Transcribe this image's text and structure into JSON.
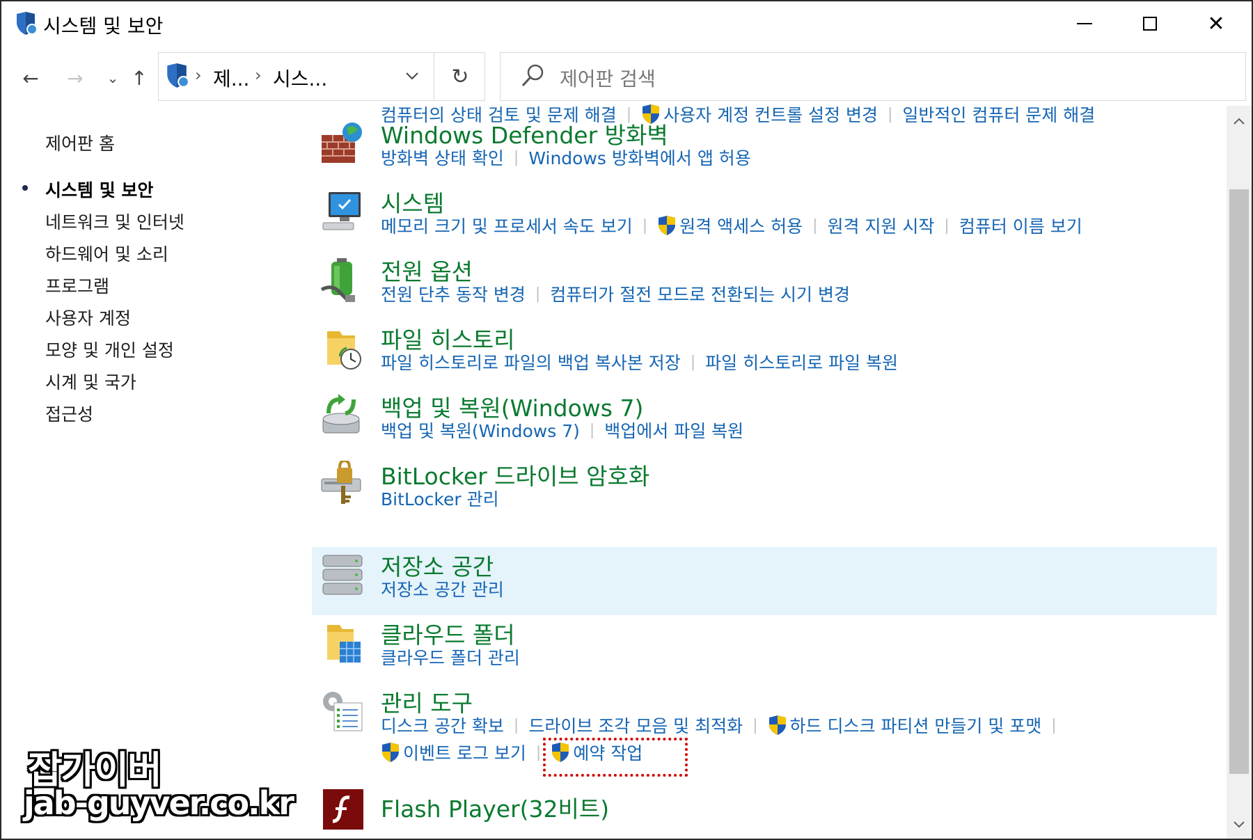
{
  "window": {
    "title": "시스템 및 보안",
    "minimize_icon": "minimize-icon",
    "maximize_icon": "maximize-icon",
    "close_glyph": "✕"
  },
  "nav": {
    "back_glyph": "←",
    "forward_glyph": "→",
    "recent_glyph": "⌄",
    "up_glyph": "↑",
    "breadcrumb_sep": "›",
    "crumbs": [
      "제...",
      "시스..."
    ],
    "refresh_glyph": "↻",
    "search_placeholder": "제어판 검색"
  },
  "sidebar": {
    "items": [
      {
        "label": "제어판 홈"
      },
      {
        "label": "시스템 및 보안",
        "active": true
      },
      {
        "label": "네트워크 및 인터넷"
      },
      {
        "label": "하드웨어 및 소리"
      },
      {
        "label": "프로그램"
      },
      {
        "label": "사용자 계정"
      },
      {
        "label": "모양 및 개인 설정"
      },
      {
        "label": "시계 및 국가"
      },
      {
        "label": "접근성"
      }
    ]
  },
  "categories": [
    {
      "title": "",
      "icon": "security-maintenance-icon",
      "links": [
        "컴퓨터의 상태 검토 및 문제 해결",
        "사용자 계정 컨트롤 설정 변경",
        "일반적인 컴퓨터 문제 해결"
      ]
    },
    {
      "title": "Windows Defender 방화벽",
      "icon": "firewall-icon",
      "links": [
        "방화벽 상태 확인",
        "Windows 방화벽에서 앱 허용"
      ]
    },
    {
      "title": "시스템",
      "icon": "computer-monitor-icon",
      "links": [
        "메모리 크기 및 프로세서 속도 보기",
        "원격 액세스 허용",
        "원격 지원 시작",
        "컴퓨터 이름 보기"
      ]
    },
    {
      "title": "전원 옵션",
      "icon": "power-battery-icon",
      "links": [
        "전원 단추 동작 변경",
        "컴퓨터가 절전 모드로 전환되는 시기 변경"
      ]
    },
    {
      "title": "파일 히스토리",
      "icon": "file-history-icon",
      "links": [
        "파일 히스토리로 파일의 백업 복사본 저장",
        "파일 히스토리로 파일 복원"
      ]
    },
    {
      "title": "백업 및 복원(Windows 7)",
      "icon": "backup-restore-icon",
      "links": [
        "백업 및 복원(Windows 7)",
        "백업에서 파일 복원"
      ]
    },
    {
      "title": "BitLocker 드라이브 암호화",
      "icon": "bitlocker-icon",
      "links": [
        "BitLocker 관리"
      ]
    },
    {
      "title": "저장소 공간",
      "icon": "storage-spaces-icon",
      "links": [
        "저장소 공간 관리"
      ]
    },
    {
      "title": "클라우드 폴더",
      "icon": "cloud-folder-icon",
      "links": [
        "클라우드 폴더 관리"
      ]
    },
    {
      "title": "관리 도구",
      "icon": "admin-tools-icon",
      "links": [
        "디스크 공간 확보",
        "드라이브 조각 모음 및 최적화",
        "하드 디스크 파티션 만들기 및 포맷",
        "이벤트 로그 보기",
        "예약 작업"
      ]
    },
    {
      "title": "Flash Player(32비트)",
      "icon": "flash-player-icon",
      "links": []
    }
  ],
  "watermark": {
    "line1": "잡가이버",
    "line2": "jab-guyver.co.kr"
  },
  "colors": {
    "title_green": "#0a7a2f",
    "link_blue": "#1565b3",
    "hover_bg": "#e5f3fb",
    "highlight_red": "#d40000"
  }
}
